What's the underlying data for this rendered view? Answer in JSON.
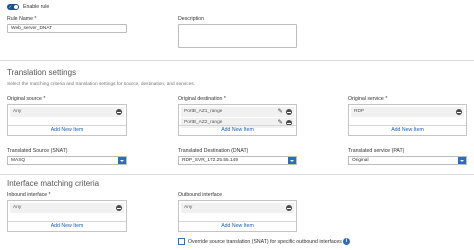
{
  "enable_rule": {
    "label": "Enable rule",
    "enabled": true
  },
  "rule_name": {
    "label": "Rule Name",
    "required_marker": "*",
    "value": "Web_server_DNAT"
  },
  "description": {
    "label": "Description",
    "value": ""
  },
  "translation_settings": {
    "title": "Translation settings",
    "hint": "Select the matching criteria and translation settings for source, destination, and services."
  },
  "original_source": {
    "label": "Original source",
    "required_marker": "*",
    "items": [
      "Any"
    ],
    "add_label": "Add New Item"
  },
  "original_destination": {
    "label": "Original destination",
    "required_marker": "*",
    "items": [
      "PortB_AZ1_range",
      "PortB_AZ2_range"
    ],
    "add_label": "Add New Item"
  },
  "original_service": {
    "label": "Original service",
    "required_marker": "*",
    "items": [
      "RDP"
    ],
    "add_label": "Add New Item"
  },
  "translated_source": {
    "label": "Translated Source (SNAT)",
    "value": "MASQ"
  },
  "translated_destination": {
    "label": "Translated Destination (DNAT)",
    "value": "RDP_SVR_172.25.55.149"
  },
  "translated_service": {
    "label": "Translated service (PAT)",
    "value": "Original"
  },
  "interface_matching": {
    "title": "Interface matching criteria"
  },
  "inbound_interface": {
    "label": "Inbound interface",
    "required_marker": "*",
    "items": [
      "Any"
    ],
    "add_label": "Add New Item"
  },
  "outbound_interface": {
    "label": "Outbound interface",
    "items": [
      "Any"
    ],
    "add_label": "Add New Item"
  },
  "override_snat": {
    "label": "Override source translation (SNAT) for specific outbound interfaces",
    "checked": false
  },
  "icons": {
    "edit": "pencil-icon",
    "remove": "minus-circle-icon",
    "dropdown": "chevron-down-icon",
    "info": "info-icon",
    "toggle": "toggle-on-icon"
  },
  "colors": {
    "accent": "#2a6ebb",
    "toggle": "#1d4f91",
    "link": "#1a5fb4",
    "list_row": "#f1f1f1"
  }
}
